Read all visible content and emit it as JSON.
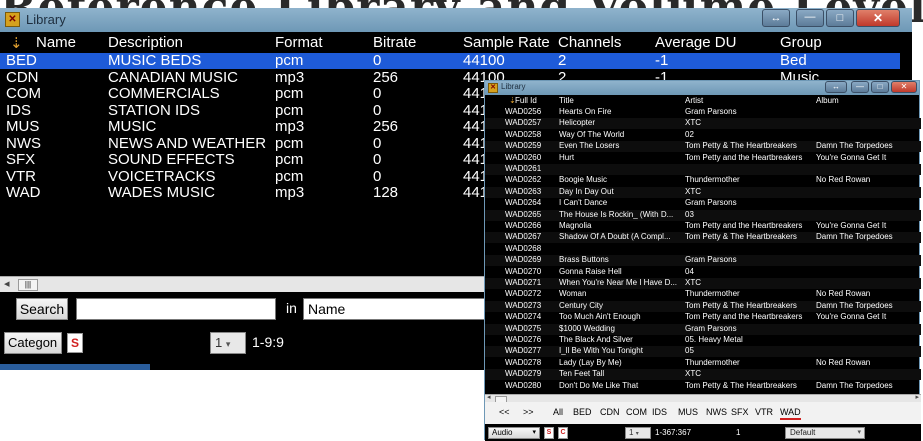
{
  "banner_text": "Reference Library and Volume Level",
  "main_window": {
    "title": "Library",
    "columns": [
      "Name",
      "Description",
      "Format",
      "Bitrate",
      "Sample Rate",
      "Channels",
      "Average DU",
      "Group"
    ],
    "rows": [
      [
        "BED",
        "MUSIC BEDS",
        "pcm",
        "0",
        "44100",
        "2",
        "-1",
        "Bed"
      ],
      [
        "CDN",
        "CANADIAN MUSIC",
        "mp3",
        "256",
        "44100",
        "2",
        "-1",
        "Music"
      ],
      [
        "COM",
        "COMMERCIALS",
        "pcm",
        "0",
        "441",
        "",
        "",
        ""
      ],
      [
        "IDS",
        "STATION IDS",
        "pcm",
        "0",
        "441",
        "",
        "",
        ""
      ],
      [
        "MUS",
        "MUSIC",
        "mp3",
        "256",
        "441",
        "",
        "",
        ""
      ],
      [
        "NWS",
        "NEWS AND WEATHER",
        "pcm",
        "0",
        "441",
        "",
        "",
        ""
      ],
      [
        "SFX",
        "SOUND EFFECTS",
        "pcm",
        "0",
        "441",
        "",
        "",
        ""
      ],
      [
        "VTR",
        "VOICETRACKS",
        "pcm",
        "0",
        "441",
        "",
        "",
        ""
      ],
      [
        "WAD",
        "WADES MUSIC",
        "mp3",
        "128",
        "441",
        "",
        "",
        ""
      ]
    ],
    "search_button": "Search",
    "search_value": "",
    "in_label": "in",
    "in_field": "Name",
    "category_select": "Categon",
    "s_button": "S",
    "page_select": "1",
    "range_text": "1-9:9"
  },
  "sub_window": {
    "title": "Library",
    "columns": [
      "Full Id",
      "Title",
      "Artist",
      "Album"
    ],
    "rows": [
      [
        "WAD0256",
        "Hearts On Fire",
        "Gram Parsons",
        ""
      ],
      [
        "WAD0257",
        "Helicopter",
        "XTC",
        ""
      ],
      [
        "WAD0258",
        "Way Of The World",
        "02",
        ""
      ],
      [
        "WAD0259",
        "Even The Losers",
        "Tom Petty & The Heartbreakers",
        "Damn The Torpedoes"
      ],
      [
        "WAD0260",
        "Hurt",
        "Tom Petty and the Heartbreakers",
        "You're Gonna Get It"
      ],
      [
        "WAD0261",
        "",
        "",
        ""
      ],
      [
        "WAD0262",
        "Boogie Music",
        "Thundermother",
        "No Red Rowan"
      ],
      [
        "WAD0263",
        "Day In Day Out",
        "XTC",
        ""
      ],
      [
        "WAD0264",
        "I Can't Dance",
        "Gram Parsons",
        ""
      ],
      [
        "WAD0265",
        "The House Is Rockin_ (With D...",
        "03",
        ""
      ],
      [
        "WAD0266",
        "Magnolia",
        "Tom Petty and the Heartbreakers",
        "You're Gonna Get It"
      ],
      [
        "WAD0267",
        "Shadow Of A Doubt (A Compl...",
        "Tom Petty & The Heartbreakers",
        "Damn The Torpedoes"
      ],
      [
        "WAD0268",
        "",
        "",
        ""
      ],
      [
        "WAD0269",
        "Brass Buttons",
        "Gram Parsons",
        ""
      ],
      [
        "WAD0270",
        "Gonna Raise Hell",
        "04",
        ""
      ],
      [
        "WAD0271",
        "When You're Near Me I Have D...",
        "XTC",
        ""
      ],
      [
        "WAD0272",
        "Woman",
        "Thundermother",
        "No Red Rowan"
      ],
      [
        "WAD0273",
        "Century City",
        "Tom Petty & The Heartbreakers",
        "Damn The Torpedoes"
      ],
      [
        "WAD0274",
        "Too Much Ain't Enough",
        "Tom Petty and the Heartbreakers",
        "You're Gonna Get It"
      ],
      [
        "WAD0275",
        "$1000 Wedding",
        "Gram Parsons",
        ""
      ],
      [
        "WAD0276",
        "The Black And Silver",
        "05. Heavy Metal",
        ""
      ],
      [
        "WAD0277",
        "I_ll Be With You Tonight",
        "05",
        ""
      ],
      [
        "WAD0278",
        "Lady (Lay By Me)",
        "Thundermother",
        "No Red Rowan"
      ],
      [
        "WAD0279",
        "Ten Feet Tall",
        "XTC",
        ""
      ],
      [
        "WAD0280",
        "Don't Do Me Like That",
        "Tom Petty & The Heartbreakers",
        "Damn The Torpedoes"
      ]
    ],
    "tabs": [
      "<<",
      ">>",
      "All",
      "BED",
      "CDN",
      "COM",
      "IDS",
      "MUS",
      "NWS",
      "SFX",
      "VTR",
      "WAD"
    ],
    "category_select": "Audio",
    "s_button": "S",
    "c_button": "C",
    "page_select": "1",
    "range_text": "1-367:367",
    "page_count": "1",
    "profile_select": "Default"
  }
}
